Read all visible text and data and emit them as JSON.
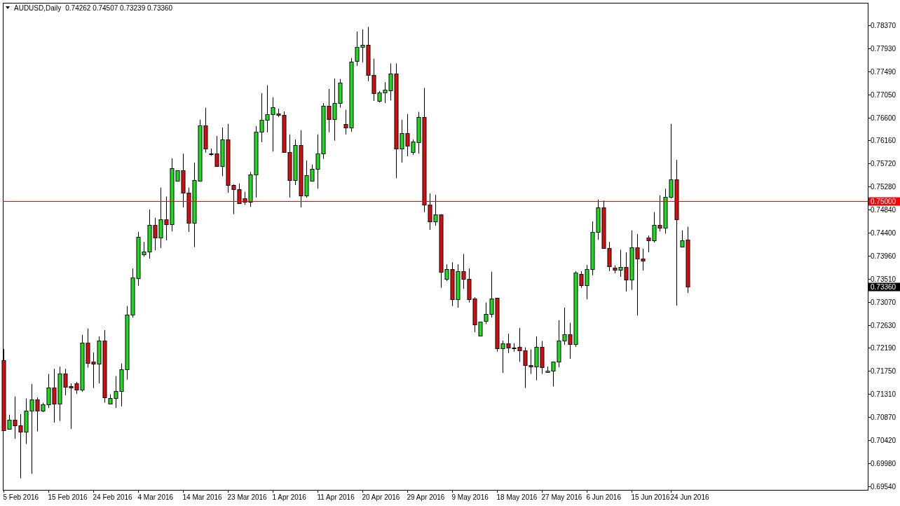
{
  "header": {
    "symbol": "AUDUSD,Daily",
    "quote": "0.74262 0.74507 0.73239 0.73360"
  },
  "price_axis": {
    "labels": [
      "0.78370",
      "0.77930",
      "0.77490",
      "0.77050",
      "0.76600",
      "0.76160",
      "0.75720",
      "0.75280",
      "0.74840",
      "0.74400",
      "0.73960",
      "0.73510",
      "0.73070",
      "0.72630",
      "0.72190",
      "0.71750",
      "0.71310",
      "0.70870",
      "0.70420",
      "0.69980",
      "0.69540"
    ]
  },
  "date_axis": {
    "labels": [
      "5 Feb 2016",
      "15 Feb 2016",
      "24 Feb 2016",
      "4 Mar 2016",
      "14 Mar 2016",
      "23 Mar 2016",
      "1 Apr 2016",
      "11 Apr 2016",
      "20 Apr 2016",
      "29 Apr 2016",
      "9 May 2016",
      "18 May 2016",
      "27 May 2016",
      "6 Jun 2016",
      "15 Jun 2016",
      "24 Jun 2016"
    ]
  },
  "price_marks": [
    {
      "kind": "line",
      "label": "0.75000",
      "color": "#ff0000"
    },
    {
      "kind": "tag",
      "label": "0.73360",
      "color": "#000000"
    }
  ]
}
